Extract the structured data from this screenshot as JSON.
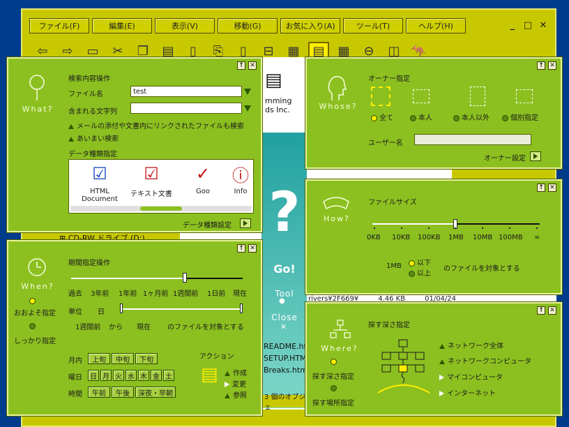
{
  "menu": [
    "ファイル(F)",
    "編集(E)",
    "表示(V)",
    "移動(G)",
    "お気に入り(A)",
    "ツール(T)",
    "ヘルプ(H)"
  ],
  "window_controls": {
    "minimize": "_",
    "maximize": "□",
    "close": "✕"
  },
  "panel_controls": {
    "pin": "↑",
    "close": "✕"
  },
  "background": {
    "folder_line1": "mming",
    "folder_line2": "ds Inc.",
    "drive": "CD-RW ドライブ (D:)",
    "qmark": "?",
    "go": "Go!",
    "tool": "Tool",
    "close": "Close",
    "files": [
      "README.htm",
      "SETUP.HTML",
      "Breaks.htm"
    ],
    "file_row": {
      "name": "rivers¥2F669¥",
      "size": "4.46 KB",
      "date": "01/04/24"
    },
    "status": "3 個のオブジェ"
  },
  "what": {
    "label": "What?",
    "title": "検索内容操作",
    "filename_label": "ファイル名",
    "filename_value": "test",
    "contains_label": "含まれる文字列",
    "contains_value": "",
    "opt1": "メールの添付や文書内にリンクされたファイルも検索",
    "opt2": "あいまい検索",
    "types_title": "データ種類指定",
    "types": [
      "HTML Document",
      "テキスト文書",
      "Goo",
      "Info"
    ],
    "types_settings": "データ種類設定"
  },
  "whose": {
    "label": "Whose?",
    "title": "オーナー指定",
    "options": [
      "全て",
      "本人",
      "本人以外",
      "個別指定"
    ],
    "selected": 0,
    "username_label": "ユーザー名",
    "username_value": "",
    "settings": "オーナー設定"
  },
  "how": {
    "label": "How?",
    "title": "ファイルサイズ",
    "scale": [
      "0KB",
      "10KB",
      "100KB",
      "1MB",
      "10MB",
      "100MB",
      "∞"
    ],
    "value_label": "1MB",
    "below": "以下",
    "above": "以上",
    "suffix": "のファイルを対象とする"
  },
  "when": {
    "label": "When?",
    "approx": "おおよそ指定",
    "exact": "しっかり指定",
    "title": "期間指定操作",
    "scale": [
      "過去",
      "3年前",
      "1年前",
      "1ヶ月前",
      "1週間前",
      "1日前",
      "現在"
    ],
    "unit_label": "単位",
    "unit_value": "日",
    "range_from": "1週間前",
    "range_kara": "から",
    "range_to": "現在",
    "range_suffix": "のファイルを対象とする",
    "month_label": "月内",
    "month_btns": [
      "上旬",
      "中旬",
      "下旬"
    ],
    "week_label": "曜日",
    "week_btns": [
      "日",
      "月",
      "火",
      "水",
      "木",
      "金",
      "土"
    ],
    "time_label": "時間",
    "time_btns": [
      "午前",
      "午後",
      "深夜・早朝"
    ],
    "action_title": "アクション",
    "actions": [
      "作成",
      "変更",
      "参照"
    ]
  },
  "where": {
    "label": "Where?",
    "title": "探す深さ指定",
    "depth": "探す深さ指定",
    "place": "探す場所指定",
    "options": [
      "ネットワーク全体",
      "ネットワークコンピュータ",
      "マイコンピュータ",
      "インターネット"
    ]
  }
}
